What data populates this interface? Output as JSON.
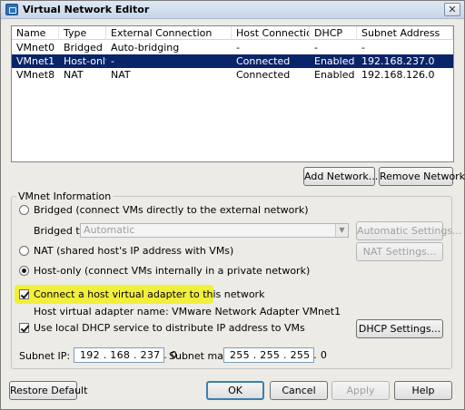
{
  "window": {
    "title": "Virtual Network Editor",
    "close_glyph": "✕"
  },
  "network_table": {
    "columns": [
      "Name",
      "Type",
      "External Connection",
      "Host Connection",
      "DHCP",
      "Subnet Address"
    ],
    "rows": [
      {
        "name": "VMnet0",
        "type": "Bridged",
        "external": "Auto-bridging",
        "host": "-",
        "dhcp": "-",
        "subnet": "-",
        "selected": false
      },
      {
        "name": "VMnet1",
        "type": "Host-only",
        "external": "-",
        "host": "Connected",
        "dhcp": "Enabled",
        "subnet": "192.168.237.0",
        "selected": true
      },
      {
        "name": "VMnet8",
        "type": "NAT",
        "external": "NAT",
        "host": "Connected",
        "dhcp": "Enabled",
        "subnet": "192.168.126.0",
        "selected": false
      }
    ]
  },
  "list_buttons": {
    "add_network": "Add Network...",
    "remove_network": "Remove Network"
  },
  "vmnet_info": {
    "group_title": "VMnet Information",
    "bridged_label": "Bridged (connect VMs directly to the external network)",
    "bridged_to_label": "Bridged to:",
    "bridged_to_value": "Automatic",
    "automatic_settings": "Automatic Settings...",
    "nat_label": "NAT (shared host's IP address with VMs)",
    "nat_settings": "NAT Settings...",
    "hostonly_label": "Host-only (connect VMs internally in a private network)",
    "selected_mode": "host-only",
    "connect_adapter_label": "Connect a host virtual adapter to this network",
    "connect_adapter_checked": true,
    "adapter_name_text": "Host virtual adapter name: VMware Network Adapter VMnet1",
    "dhcp_label": "Use local DHCP service to distribute IP address to VMs",
    "dhcp_checked": true,
    "dhcp_settings": "DHCP Settings...",
    "subnet_ip_label": "Subnet IP:",
    "subnet_ip_value": "192 . 168 . 237 .  0",
    "subnet_mask_label": "Subnet mask:",
    "subnet_mask_value": "255 . 255 . 255 .  0"
  },
  "footer": {
    "restore_default": "Restore Default",
    "ok": "OK",
    "cancel": "Cancel",
    "apply": "Apply",
    "help": "Help"
  },
  "colors": {
    "selected_row": "#0a246a",
    "highlight": "#f2ef3c",
    "window_bg": "#ecebe6"
  }
}
